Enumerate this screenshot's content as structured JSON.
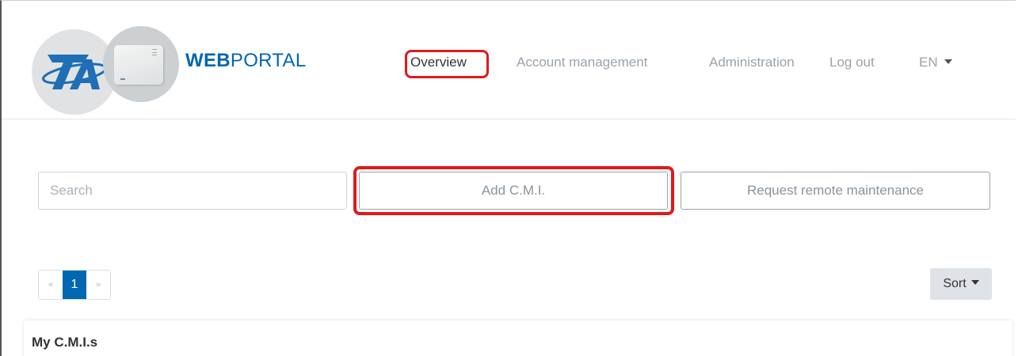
{
  "header": {
    "brand_bold": "WEB",
    "brand_light": "PORTAL",
    "nav": {
      "overview": "Overview",
      "account": "Account management",
      "admin": "Administration",
      "logout": "Log out",
      "language": "EN"
    }
  },
  "controls": {
    "search_placeholder": "Search",
    "add_label": "Add C.M.I.",
    "remote_label": "Request remote maintenance"
  },
  "pagination": {
    "prev": "«",
    "current": "1",
    "next": "»"
  },
  "sort_label": "Sort",
  "list": {
    "title": "My C.M.I.s"
  },
  "colors": {
    "brand": "#0067b0",
    "highlight": "#e01a1a"
  }
}
